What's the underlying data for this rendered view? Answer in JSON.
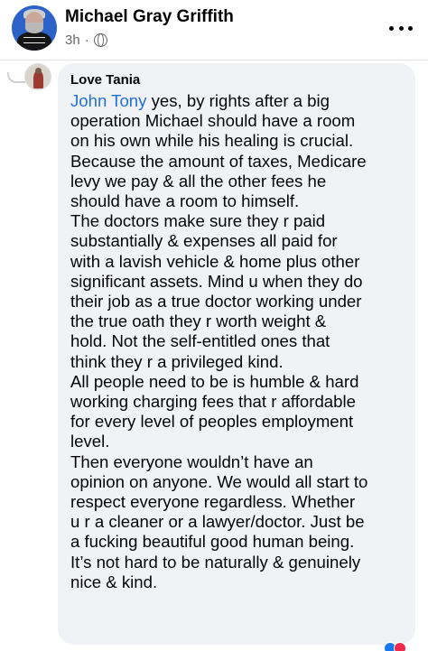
{
  "post": {
    "author": "Michael Gray Griffith",
    "time": "3h",
    "separator": "·",
    "privacy_icon": "globe-icon",
    "menu_icon": "more-horizontal-icon"
  },
  "comment": {
    "author": "Love Tania",
    "mention": "John Tony",
    "text": " yes, by rights after a big\noperation Michael should have a room\non his own while his healing is crucial.\nBecause the amount of taxes, Medicare\nlevy we pay & all the other fees he\nshould have a room to himself.\nThe doctors make sure they r paid\nsubstantially & expenses all paid for\nwith a lavish vehicle & home plus other\nsignificant assets. Mind u when they do\ntheir job as a true doctor working under\nthe true oath they r worth weight &\nhold. Not the self-entitled ones that\nthink they r a privileged kind.\nAll people need to be is humble & hard\nworking charging fees that r affordable\nfor every level of peoples employment\nlevel.\nThen everyone wouldn’t have an\nopinion on anyone. We would all start to\nrespect everyone regardless. Whether\nu r a cleaner or a lawyer/doctor. Just be\na fucking beautiful good human being.\nIt’s not hard to be naturally & genuinely\nnice & kind."
  },
  "colors": {
    "background": "#ffffff",
    "comment_bubble": "#f0f2f5",
    "mention": "#216fdb",
    "secondary_text": "#65676b"
  }
}
